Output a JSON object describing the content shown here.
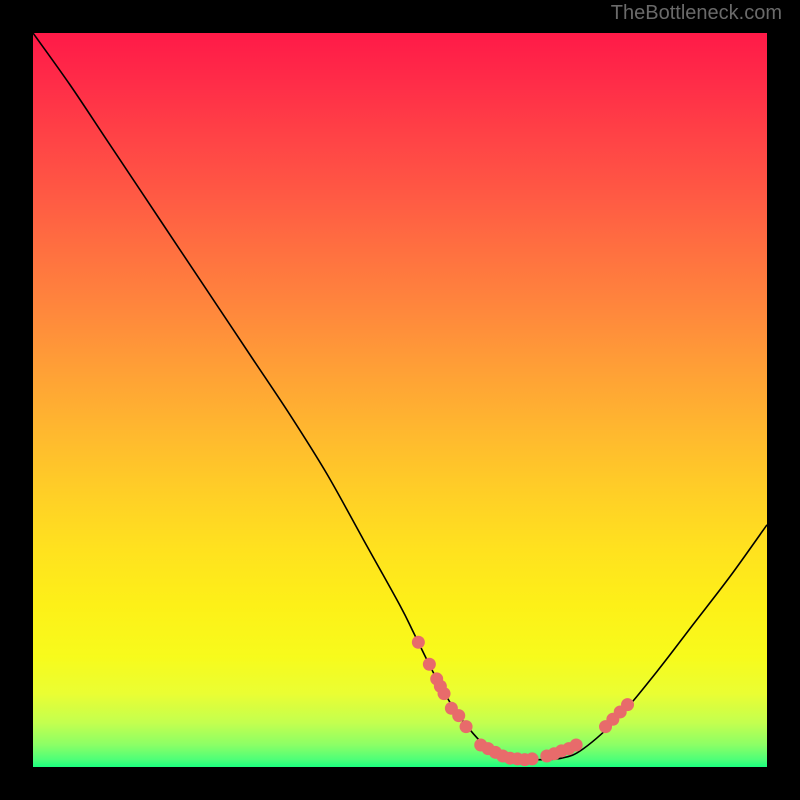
{
  "attribution": "TheBottleneck.com",
  "chart_data": {
    "type": "line",
    "title": "",
    "xlabel": "",
    "ylabel": "",
    "xlim": [
      0,
      100
    ],
    "ylim": [
      0,
      100
    ],
    "curve": {
      "x": [
        0,
        5,
        10,
        15,
        20,
        25,
        30,
        35,
        40,
        45,
        50,
        52,
        55,
        58,
        62,
        65,
        68,
        72,
        75,
        80,
        85,
        90,
        95,
        100
      ],
      "y": [
        100,
        93,
        85.5,
        78,
        70.5,
        63,
        55.5,
        48,
        40,
        31,
        22,
        18,
        12,
        7,
        2.5,
        1.2,
        1.0,
        1.2,
        2.5,
        7,
        13,
        19.5,
        26,
        33
      ]
    },
    "markers": {
      "x": [
        52.5,
        54,
        55,
        55.5,
        56,
        57,
        58,
        59,
        61,
        62,
        63,
        64,
        65,
        66,
        67,
        68,
        70,
        71,
        72,
        73,
        74,
        78,
        79,
        80,
        81
      ],
      "y": [
        17,
        14,
        12,
        11,
        10,
        8,
        7,
        5.5,
        3,
        2.5,
        2,
        1.5,
        1.2,
        1.1,
        1.0,
        1.1,
        1.5,
        1.8,
        2.2,
        2.5,
        3.0,
        5.5,
        6.5,
        7.5,
        8.5
      ]
    },
    "gradient_stops": [
      {
        "offset": 0.0,
        "color": "#ff1a48"
      },
      {
        "offset": 0.06,
        "color": "#ff2a48"
      },
      {
        "offset": 0.14,
        "color": "#ff4246"
      },
      {
        "offset": 0.22,
        "color": "#ff5944"
      },
      {
        "offset": 0.3,
        "color": "#ff7140"
      },
      {
        "offset": 0.38,
        "color": "#ff883c"
      },
      {
        "offset": 0.46,
        "color": "#ffa036"
      },
      {
        "offset": 0.54,
        "color": "#ffb72f"
      },
      {
        "offset": 0.62,
        "color": "#ffcd27"
      },
      {
        "offset": 0.7,
        "color": "#ffe11f"
      },
      {
        "offset": 0.78,
        "color": "#fdf018"
      },
      {
        "offset": 0.85,
        "color": "#f7fb1c"
      },
      {
        "offset": 0.9,
        "color": "#eafe33"
      },
      {
        "offset": 0.94,
        "color": "#c3ff4f"
      },
      {
        "offset": 0.97,
        "color": "#8bff66"
      },
      {
        "offset": 0.99,
        "color": "#4dff78"
      },
      {
        "offset": 1.0,
        "color": "#1aff7e"
      }
    ],
    "marker_color": "#e86b6b",
    "line_color": "#000000"
  }
}
